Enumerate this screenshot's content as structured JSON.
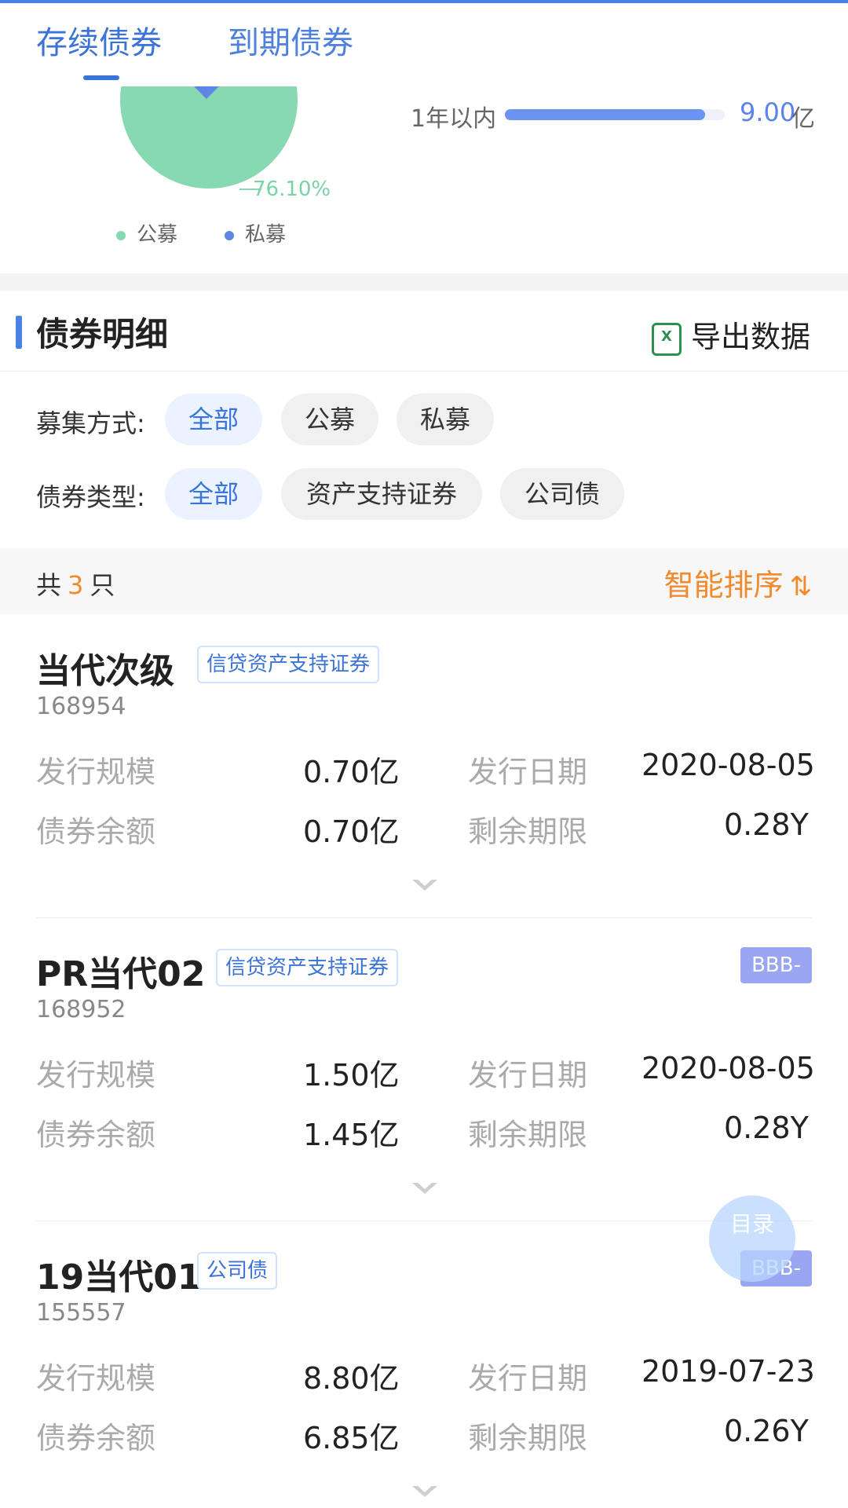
{
  "tabs": [
    {
      "label": "存续债券"
    },
    {
      "label": "到期债券"
    }
  ],
  "overview": {
    "pie_percent": "76.10%",
    "legend": [
      {
        "label": "公募",
        "color": "#86d9b0"
      },
      {
        "label": "私募",
        "color": "#5f86e6"
      }
    ],
    "progress": {
      "label": "1年以内",
      "value": "9.00",
      "unit": "亿",
      "fraction": 0.91
    }
  },
  "section": {
    "title": "债券明细",
    "export_label": "导出数据",
    "export_icon": "excel-icon"
  },
  "filters": {
    "raise_method": {
      "label": "募集方式:",
      "options": [
        "全部",
        "公募",
        "私募"
      ],
      "selected": "全部"
    },
    "bond_type": {
      "label": "债券类型:",
      "options": [
        "全部",
        "资产支持证券",
        "公司债"
      ],
      "selected": "全部"
    }
  },
  "summary": {
    "prefix": "共",
    "count": "3",
    "suffix": "只",
    "sort_label": "智能排序",
    "sort_icon": "sort-icon"
  },
  "bonds": [
    {
      "name": "当代次级",
      "tag": "信贷资产支持证券",
      "rating": "",
      "code": "168954",
      "issue_size_label": "发行规模",
      "issue_size": "0.70亿",
      "issue_date_label": "发行日期",
      "issue_date": "2020-08-05",
      "balance_label": "债券余额",
      "balance": "0.70亿",
      "remaining_label": "剩余期限",
      "remaining": "0.28Y"
    },
    {
      "name": "PR当代02",
      "tag": "信贷资产支持证券",
      "rating": "BBB-",
      "code": "168952",
      "issue_size_label": "发行规模",
      "issue_size": "1.50亿",
      "issue_date_label": "发行日期",
      "issue_date": "2020-08-05",
      "balance_label": "债券余额",
      "balance": "1.45亿",
      "remaining_label": "剩余期限",
      "remaining": "0.28Y"
    },
    {
      "name": "19当代01",
      "tag": "公司债",
      "rating": "BBB-",
      "code": "155557",
      "issue_size_label": "发行规模",
      "issue_size": "8.80亿",
      "issue_date_label": "发行日期",
      "issue_date": "2019-07-23",
      "balance_label": "债券余额",
      "balance": "6.85亿",
      "remaining_label": "剩余期限",
      "remaining": "0.26Y"
    }
  ],
  "fab": {
    "label": "目录"
  }
}
